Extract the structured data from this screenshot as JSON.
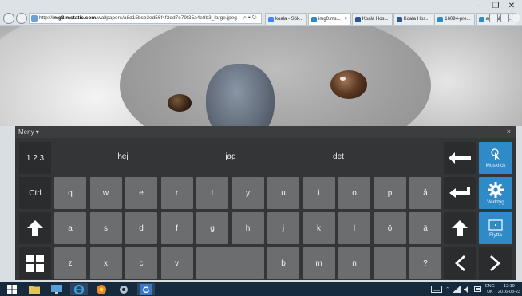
{
  "browser": {
    "window_controls": [
      "–",
      "❐",
      "✕"
    ],
    "address_host": "img8.mstatic.com",
    "address_prefix": "http://",
    "address_path": "/wallpapers/a8d15bcb3ed56f4f2dd7e79f35a4e8b3_large.jpeg",
    "address_tools": "⌕ ▾ ↻",
    "tabs": [
      {
        "label": "koala - Sök...",
        "icon": "google-g-icon",
        "color": "#4285f4",
        "active": false
      },
      {
        "label": "img0.ms...",
        "icon": "ie-tab-icon",
        "color": "#2f8ac8",
        "active": true,
        "close": "×"
      },
      {
        "label": "Koala Hos...",
        "icon": "x-tab-icon",
        "color": "#2b5797",
        "active": false
      },
      {
        "label": "Koala Hos...",
        "icon": "x-tab-icon",
        "color": "#2b5797",
        "active": false
      },
      {
        "label": "16094-pre...",
        "icon": "ie-tab-icon",
        "color": "#2f8ac8",
        "active": false
      },
      {
        "label": "animals.sa...",
        "icon": "ie-tab-icon",
        "color": "#2f8ac8",
        "active": false
      }
    ]
  },
  "keyboard": {
    "menu_label": "Meny",
    "menu_caret": "▾",
    "close_label": "×",
    "numbers_key": "1 2 3",
    "suggestions": [
      "hej",
      "jag",
      "det"
    ],
    "ctrl_key": "Ctrl",
    "row1": [
      "q",
      "w",
      "e",
      "r",
      "t",
      "y",
      "u",
      "i",
      "o",
      "p",
      "å"
    ],
    "row2": [
      "a",
      "s",
      "d",
      "f",
      "g",
      "h",
      "j",
      "k",
      "l",
      "ö",
      "ä"
    ],
    "row3": [
      "z",
      "x",
      "c",
      "v",
      "b",
      "m",
      "n",
      ".",
      "?"
    ],
    "side_buttons": [
      {
        "label": "Musklick",
        "icon": "mouse-click-icon"
      },
      {
        "label": "Verktyg",
        "icon": "gear-icon"
      },
      {
        "label": "Flytta",
        "icon": "move-icon"
      }
    ],
    "accent_color": "#2f8ac8"
  },
  "taskbar": {
    "clock_time": "12:19",
    "clock_date": "2016-03-23",
    "lang_code": "ENG",
    "lang_region": "UK",
    "apps": [
      "start-icon",
      "file-explorer-icon",
      "remote-desktop-icon",
      "internet-explorer-icon",
      "media-app-icon",
      "settings-app-icon",
      "google-app-icon"
    ]
  }
}
